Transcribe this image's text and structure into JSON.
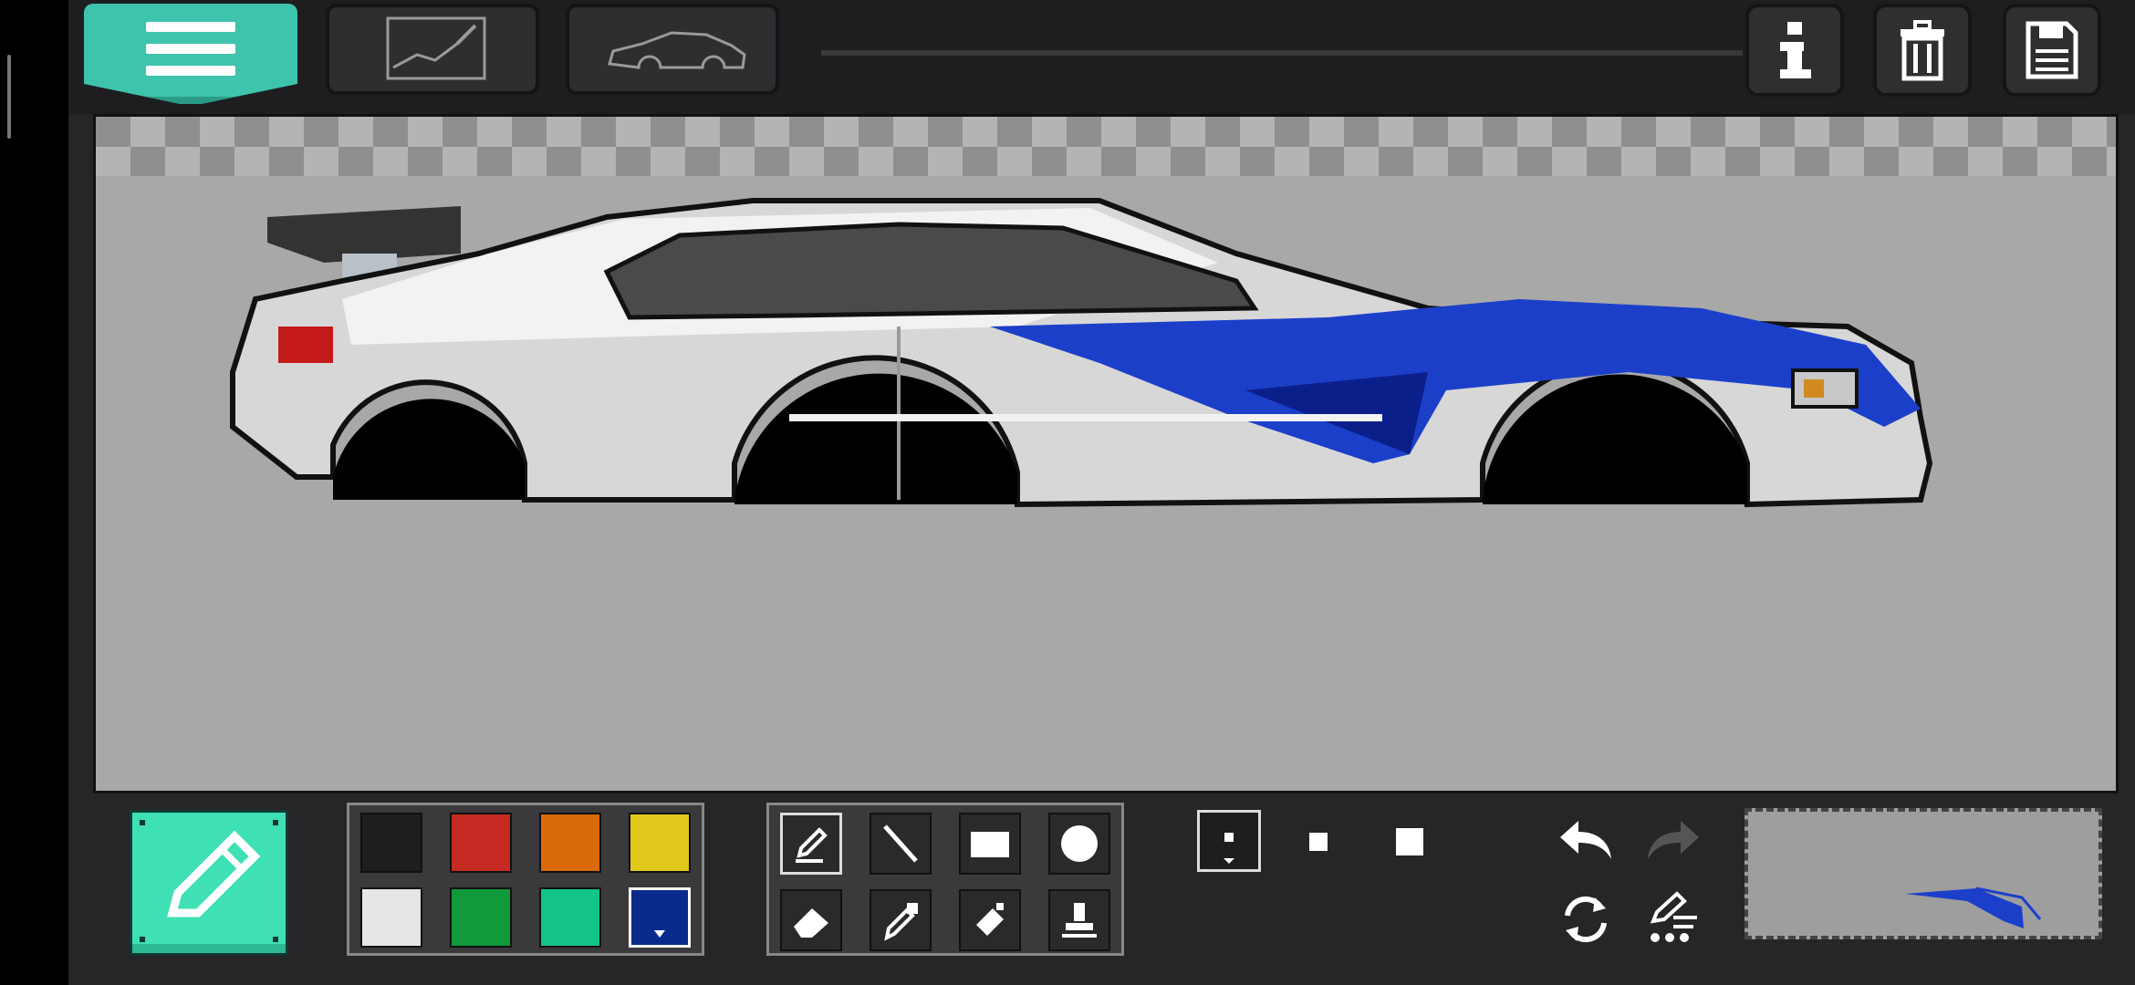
{
  "app": {
    "toolbar": {
      "menu": "hamburger-icon",
      "tabs": [
        "sketch-tab-icon",
        "car-outline-icon"
      ],
      "right": [
        "info-icon",
        "trash-icon",
        "save-icon"
      ]
    },
    "colors": {
      "accent": "#3ec4ac",
      "pencil_button": "#3ee0b4",
      "canvas_bg": "#a8a8a8"
    }
  },
  "palette": {
    "swatches": [
      "#1e1e1e",
      "#c42a22",
      "#d96a0a",
      "#e2c81c",
      "#e6e6e6",
      "#109a3a",
      "#12c48a",
      "#0a2a8c"
    ],
    "selected_index": 7
  },
  "tools": [
    "pencil-icon",
    "line-icon",
    "rectangle-icon",
    "circle-icon",
    "eraser-icon",
    "eyedropper-icon",
    "spray-can-icon",
    "stamp-icon"
  ],
  "brush_sizes": [
    "small",
    "medium",
    "large"
  ],
  "history": [
    "undo-icon",
    "redo-icon",
    "rotate-icon",
    "brush-settings-icon"
  ]
}
